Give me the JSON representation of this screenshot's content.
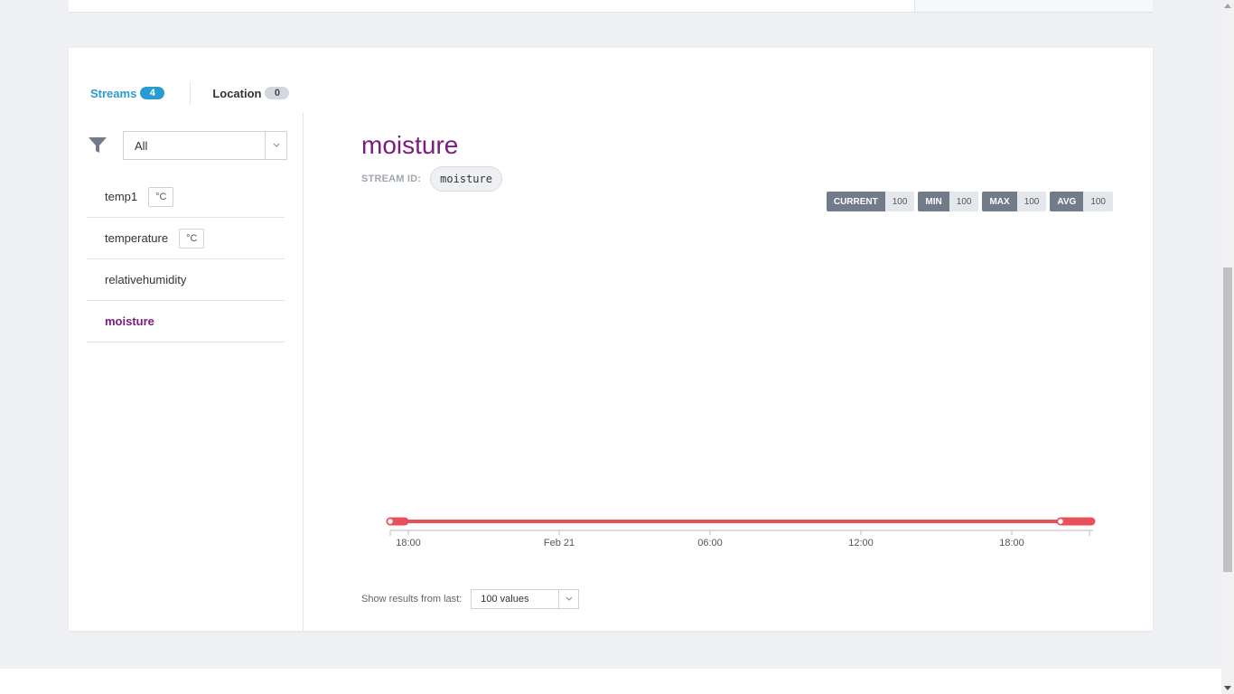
{
  "tabs": [
    {
      "label": "Streams",
      "count": "4"
    },
    {
      "label": "Location",
      "count": "0"
    }
  ],
  "filter": {
    "selected": "All"
  },
  "streams": [
    {
      "name": "temp1",
      "unit": "°C"
    },
    {
      "name": "temperature",
      "unit": "°C"
    },
    {
      "name": "relativehumidity",
      "unit": ""
    },
    {
      "name": "moisture",
      "unit": ""
    }
  ],
  "selected_stream": {
    "title": "moisture",
    "id_label": "STREAM ID:",
    "id_value": "moisture"
  },
  "stats": [
    {
      "key": "CURRENT",
      "value": "100"
    },
    {
      "key": "MIN",
      "value": "100"
    },
    {
      "key": "MAX",
      "value": "100"
    },
    {
      "key": "AVG",
      "value": "100"
    }
  ],
  "chart_data": {
    "type": "line",
    "x_ticks": [
      "18:00",
      "Feb 21",
      "06:00",
      "12:00",
      "18:00"
    ],
    "series": [
      {
        "color": "#e8505b",
        "y": 100
      }
    ],
    "grid": false
  },
  "results": {
    "label": "Show results from last:",
    "selected": "100 values"
  },
  "colors": {
    "accent": "#2a9bd1",
    "stream_title": "#7d1a7d",
    "series": "#e8505b"
  }
}
